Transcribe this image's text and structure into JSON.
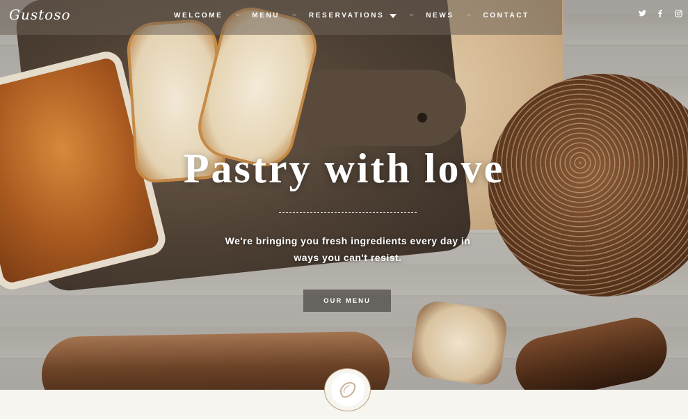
{
  "brand": {
    "logo": "Gustoso"
  },
  "nav": {
    "items": [
      {
        "label": "WELCOME"
      },
      {
        "label": "MENU"
      },
      {
        "label": "RESERVATIONS"
      },
      {
        "label": "NEWS"
      },
      {
        "label": "CONTACT"
      }
    ],
    "separator": "~",
    "social": [
      {
        "icon": "twitter-icon",
        "glyph": "t"
      },
      {
        "icon": "facebook-icon",
        "glyph": "f"
      },
      {
        "icon": "instagram-icon",
        "glyph": "◎"
      }
    ]
  },
  "hero": {
    "title": "Pastry with love",
    "subtitle": "We're bringing you fresh ingredients every day in ways you can't resist.",
    "cta_label": "OUR MENU"
  },
  "section": {
    "badge_icon": "lemon-icon"
  },
  "colors": {
    "nav_band": "#6e6258",
    "button_bg": "#4b4642",
    "badge_border": "#b99a7a",
    "page_bg": "#f7f5f0"
  }
}
